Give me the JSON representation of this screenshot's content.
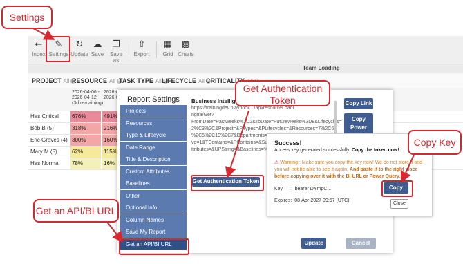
{
  "toolbar": {
    "index": "Index",
    "settings": "Settings",
    "update": "Update",
    "save": "Save",
    "save_as": "Save as",
    "export": "Export",
    "grid": "Grid",
    "charts": "Charts"
  },
  "team_loading": "Team Loading",
  "filters": [
    {
      "label": "PROJECT",
      "all": "All"
    },
    {
      "label": "RESOURCE",
      "all": "All"
    },
    {
      "label": "TASK TYPE",
      "all": "All"
    },
    {
      "label": "LIFECYCLE",
      "all": "All"
    },
    {
      "label": "CRITICALITY",
      "all": "All"
    }
  ],
  "grid": {
    "col1_line1": "2026-04-06 -",
    "col1_line2": "2026-04-12",
    "col1_line3": "(3d remaining)",
    "col2_line1": "2026-04-",
    "col2_line2": "2026-04-",
    "rows": [
      {
        "name": "Has Critical",
        "v1": "676%",
        "v2": "491%",
        "color": "#e98a9b"
      },
      {
        "name": "Bob B (5)",
        "v1": "318%",
        "v2": "216%",
        "color": "#f2a6a6"
      },
      {
        "name": "Eric Graves (4)",
        "v1": "300%",
        "v2": "160%",
        "color": "#f2a6a6"
      },
      {
        "name": "Mary M (5)",
        "v1": "62%",
        "v2": "115%",
        "color": "#f7e99a"
      },
      {
        "name": "Has Normal",
        "v1": "78%",
        "v2": "16%",
        "color": "#f3f0b8"
      }
    ]
  },
  "dialog": {
    "title": "Report Settings",
    "menu": [
      "Projects",
      "Resources",
      "Type & Lifecycle",
      "Date Range",
      "Title & Description",
      "Custom Attributes",
      "Baselines",
      "Other",
      "Optional Info",
      "Column Names",
      "Save My Report",
      "Get an API/BI URL"
    ],
    "bi_label": "Business Intelligence(BI",
    "url_lines": [
      "https://trainingdev.playbook.../api/resourceLoadi",
      "ng8a/Get?",
      "FromDate=Pastweeks%3D2&ToDate=Futureweeks%3D8&Lifecycles=",
      "2%C3%2C&Project=&PTypes=&PLifecycles=&Resources=7%2C65",
      "%2C5%2C19%2C7&Departments=",
      "ve=1&TContains=&PContains=&Sum",
      "ttributes=&UPString=&Baselines=%5"
    ],
    "copy_link": "Copy Link",
    "copy_power_query": "Copy Power Query",
    "get_token": "Get Authentication Token",
    "update": "Update",
    "cancel": "Cancel"
  },
  "success": {
    "title": "Success!",
    "message_prefix": "Access key generated successfully.",
    "message_bold": "Copy the token now!",
    "warning_prefix": "Warning : Make sure you copy the key now! We do not store it and you will not be able to see it again.",
    "warning_bold": "And paste it to the right place before copying over it with the BI URL or Power Query.",
    "key_label": "Key",
    "key_sep": ":",
    "key_value": "bearer DYmpC...",
    "copy_key": "Copy Key",
    "expires_label": "Expires:",
    "expires_value": "08-Apr-2027 09:57 (UTC)",
    "close": "Close"
  },
  "callouts": {
    "settings": "Settings",
    "get_auth_token": "Get Authentication Token",
    "copy_key": "Copy Key",
    "get_api_url": "Get an API/BI URL"
  },
  "colors": {
    "annotation_red": "#d8282f",
    "menu_blue": "#5b7bb0",
    "button_blue": "#3f5d91",
    "warning_orange": "#e07d1f"
  }
}
